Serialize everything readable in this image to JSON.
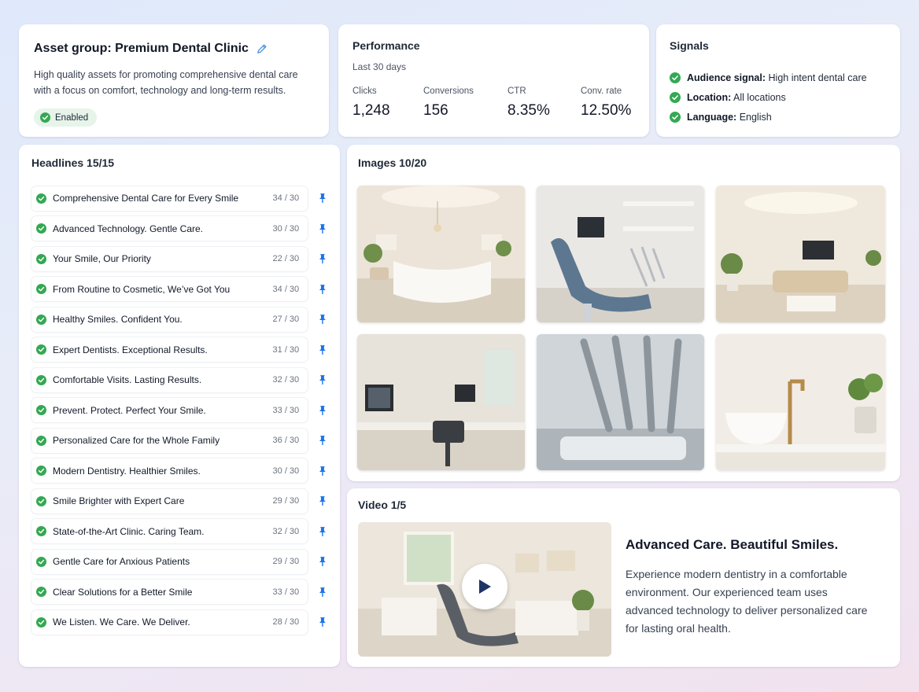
{
  "asset_group": {
    "title": "Asset group: Premium Dental Clinic",
    "description": "High quality assets for promoting comprehensive dental care with a focus on comfort, technology and long-term results.",
    "status": "Enabled"
  },
  "performance": {
    "title": "Performance",
    "period": "Last 30 days",
    "metrics": [
      {
        "label": "Clicks",
        "value": "1,248"
      },
      {
        "label": "Conversions",
        "value": "156"
      },
      {
        "label": "CTR",
        "value": "8.35%"
      },
      {
        "label": "Conv. rate",
        "value": "12.50%"
      }
    ]
  },
  "signals": {
    "title": "Signals",
    "items": [
      {
        "key": "Audience signal:",
        "value": "High intent dental care"
      },
      {
        "key": "Location:",
        "value": "All locations"
      },
      {
        "key": "Language:",
        "value": "English"
      }
    ]
  },
  "headlines": {
    "title": "Headlines 15/15",
    "items": [
      {
        "text": "Comprehensive Dental Care for Every Smile",
        "count": "34 / 30"
      },
      {
        "text": "Advanced Technology. Gentle Care.",
        "count": "30 / 30"
      },
      {
        "text": "Your Smile, Our Priority",
        "count": "22 / 30"
      },
      {
        "text": "From Routine to Cosmetic, We’ve Got You",
        "count": "34 / 30"
      },
      {
        "text": "Healthy Smiles. Confident You.",
        "count": "27 / 30"
      },
      {
        "text": "Expert Dentists. Exceptional Results.",
        "count": "31 / 30"
      },
      {
        "text": "Comfortable Visits. Lasting Results.",
        "count": "32 / 30"
      },
      {
        "text": "Prevent. Protect. Perfect Your Smile.",
        "count": "33 / 30"
      },
      {
        "text": "Personalized Care for the Whole Family",
        "count": "36 / 30"
      },
      {
        "text": "Modern Dentistry. Healthier Smiles.",
        "count": "30 / 30"
      },
      {
        "text": "Smile Brighter with Expert Care",
        "count": "29 / 30"
      },
      {
        "text": "State-of-the-Art Clinic. Caring Team.",
        "count": "32 / 30"
      },
      {
        "text": "Gentle Care for Anxious Patients",
        "count": "29 / 30"
      },
      {
        "text": "Clear Solutions for a Better Smile",
        "count": "33 / 30"
      },
      {
        "text": "We Listen. We Care. We Deliver.",
        "count": "28 / 30"
      }
    ]
  },
  "images": {
    "title": "Images 10/20"
  },
  "video": {
    "title": "Video 1/5",
    "headline": "Advanced Care. Beautiful Smiles.",
    "description": "Experience modern dentistry in a comfortable environment. Our experienced team uses advanced technology to deliver personalized care for lasting oral health."
  },
  "colors": {
    "check_green": "#34a853",
    "pin_blue": "#1a73e8",
    "pencil_blue": "#4a8fe0",
    "badge_bg": "#e6f4ea"
  }
}
